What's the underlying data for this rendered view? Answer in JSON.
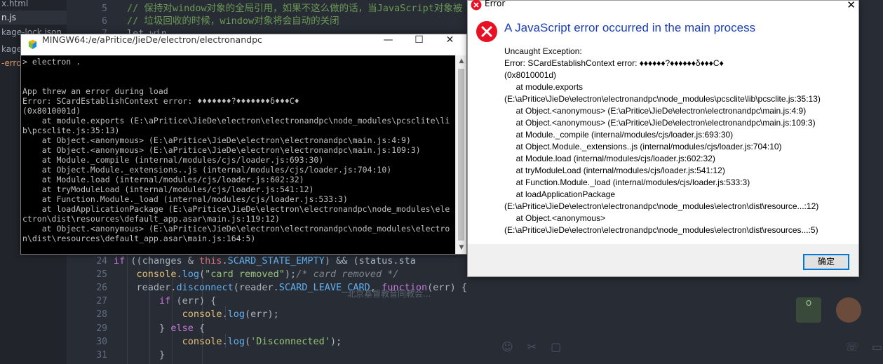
{
  "file_tree": {
    "items": [
      "x.html",
      "n.js",
      "kage-lock.json",
      "kage.j",
      "-erro"
    ]
  },
  "editor": {
    "top_lines": [
      {
        "num": "5",
        "text": "// 保持对window对象的全局引用，如果不这么做的话，当JavaScript对象被"
      },
      {
        "num": "6",
        "text": "// 垃圾回收的时候，window对象将会自动的关闭"
      },
      {
        "num": "7",
        "text": "let win"
      }
    ],
    "bottom_lines": [
      {
        "num": "24",
        "parts": [
          [
            "plain",
            "        "
          ],
          [
            "kw",
            "if"
          ],
          [
            "plain",
            " (("
          ],
          [
            "plain",
            "changes "
          ],
          [
            "plain",
            "& "
          ],
          [
            "this",
            "this"
          ],
          [
            "plain",
            "."
          ],
          [
            "prop",
            "SCARD_STATE_EMPTY"
          ],
          [
            "plain",
            ") && ("
          ],
          [
            "plain",
            "status.sta"
          ]
        ]
      },
      {
        "num": "25",
        "parts": [
          [
            "plain",
            "            "
          ],
          [
            "var",
            "console"
          ],
          [
            "plain",
            "."
          ],
          [
            "fn",
            "log"
          ],
          [
            "plain",
            "("
          ],
          [
            "str",
            "\"card removed\""
          ],
          [
            "plain",
            ");"
          ],
          [
            "comment",
            "/* card removed */"
          ]
        ]
      },
      {
        "num": "26",
        "parts": [
          [
            "plain",
            "            reader."
          ],
          [
            "fn",
            "disconnect"
          ],
          [
            "plain",
            "(reader."
          ],
          [
            "prop",
            "SCARD_LEAVE_CARD"
          ],
          [
            "plain",
            ", "
          ],
          [
            "kw",
            "function"
          ],
          [
            "plain",
            "(err) {"
          ]
        ]
      },
      {
        "num": "27",
        "parts": [
          [
            "plain",
            "                "
          ],
          [
            "kw",
            "if"
          ],
          [
            "plain",
            " (err) {"
          ]
        ]
      },
      {
        "num": "28",
        "parts": [
          [
            "plain",
            "                    "
          ],
          [
            "var",
            "console"
          ],
          [
            "plain",
            "."
          ],
          [
            "fn",
            "log"
          ],
          [
            "plain",
            "(err);"
          ]
        ]
      },
      {
        "num": "29",
        "parts": [
          [
            "plain",
            "                } "
          ],
          [
            "kw",
            "else"
          ],
          [
            "plain",
            " {"
          ]
        ]
      },
      {
        "num": "30",
        "parts": [
          [
            "plain",
            "                    "
          ],
          [
            "var",
            "console"
          ],
          [
            "plain",
            "."
          ],
          [
            "fn",
            "log"
          ],
          [
            "plain",
            "("
          ],
          [
            "str",
            "'Disconnected'"
          ],
          [
            "plain",
            ");"
          ]
        ]
      },
      {
        "num": "31",
        "parts": [
          [
            "plain",
            "                }"
          ]
        ]
      }
    ],
    "chat_ghost_text": "北京基督教音同教会...",
    "chat_bubble": "o"
  },
  "terminal": {
    "title": "MINGW64:/e/aPritice/JieDe/electron/electronandpc",
    "minimize": "—",
    "maximize": "☐",
    "close": "✕",
    "lines": [
      "> electron .",
      "",
      "",
      "App threw an error during load",
      "Error: SCardEstablishContext error: ♦♦♦♦♦♦♦?♦♦♦♦♦♦♦δ♦♦♦C♦",
      "(0x8010001d)",
      "    at module.exports (E:\\aPritice\\JieDe\\electron\\electronandpc\\node_modules\\pcsclite\\li",
      "b\\pcsclite.js:35:13)",
      "    at Object.<anonymous> (E:\\aPritice\\JieDe\\electron\\electronandpc\\main.js:4:9)",
      "    at Object.<anonymous> (E:\\aPritice\\JieDe\\electron\\electronandpc\\main.js:109:3)",
      "    at Module._compile (internal/modules/cjs/loader.js:693:30)",
      "    at Object.Module._extensions..js (internal/modules/cjs/loader.js:704:10)",
      "    at Module.load (internal/modules/cjs/loader.js:602:32)",
      "    at tryModuleLoad (internal/modules/cjs/loader.js:541:12)",
      "    at Function.Module._load (internal/modules/cjs/loader.js:533:3)",
      "    at loadApplicationPackage (E:\\aPritice\\JieDe\\electron\\electronandpc\\node_modules\\ele",
      "ctron\\dist\\resources\\default_app.asar\\main.js:119:12)",
      "    at Object.<anonymous> (E:\\aPritice\\JieDe\\electron\\electronandpc\\node_modules\\electro",
      "n\\dist\\resources\\default_app.asar\\main.js:164:5)"
    ]
  },
  "dialog": {
    "title": "Error",
    "close": "✕",
    "heading": "A JavaScript error occurred in the main process",
    "message_lines": [
      "Uncaught Exception:",
      "Error: SCardEstablishContext error: ♦♦♦♦♦♦?♦♦♦♦♦♦δ♦♦♦C♦",
      "(0x8010001d)",
      "     at module.exports",
      "(E:\\aPritice\\JieDe\\electron\\electronandpc\\node_modules\\pcsclite\\lib\\pcsclite.js:35:13)",
      "     at Object.<anonymous> (E:\\aPritice\\JieDe\\electron\\electronandpc\\main.js:4:9)",
      "     at Object.<anonymous> (E:\\aPritice\\JieDe\\electron\\electronandpc\\main.js:109:3)",
      "     at Module._compile (internal/modules/cjs/loader.js:693:30)",
      "     at Object.Module._extensions..js (internal/modules/cjs/loader.js:704:10)",
      "     at Module.load (internal/modules/cjs/loader.js:602:32)",
      "     at tryModuleLoad (internal/modules/cjs/loader.js:541:12)",
      "     at Function.Module._load (internal/modules/cjs/loader.js:533:3)",
      "     at loadApplicationPackage",
      "(E:\\aPritice\\JieDe\\electron\\electronandpc\\node_modules\\electron\\dist\\resource...:12)",
      "     at Object.<anonymous>",
      "(E:\\aPritice\\JieDe\\electron\\electronandpc\\node_modules\\electron\\dist\\resources...:5)"
    ],
    "ok_label": "确定"
  },
  "colors": {
    "heading_blue": "#1c3fb0",
    "error_red": "#e81123",
    "focus_blue": "#0078d7"
  },
  "icons": {
    "dialog_title": "error-icon",
    "dialog_big": "error-circle-icon",
    "terminal": "mingw-icon"
  }
}
